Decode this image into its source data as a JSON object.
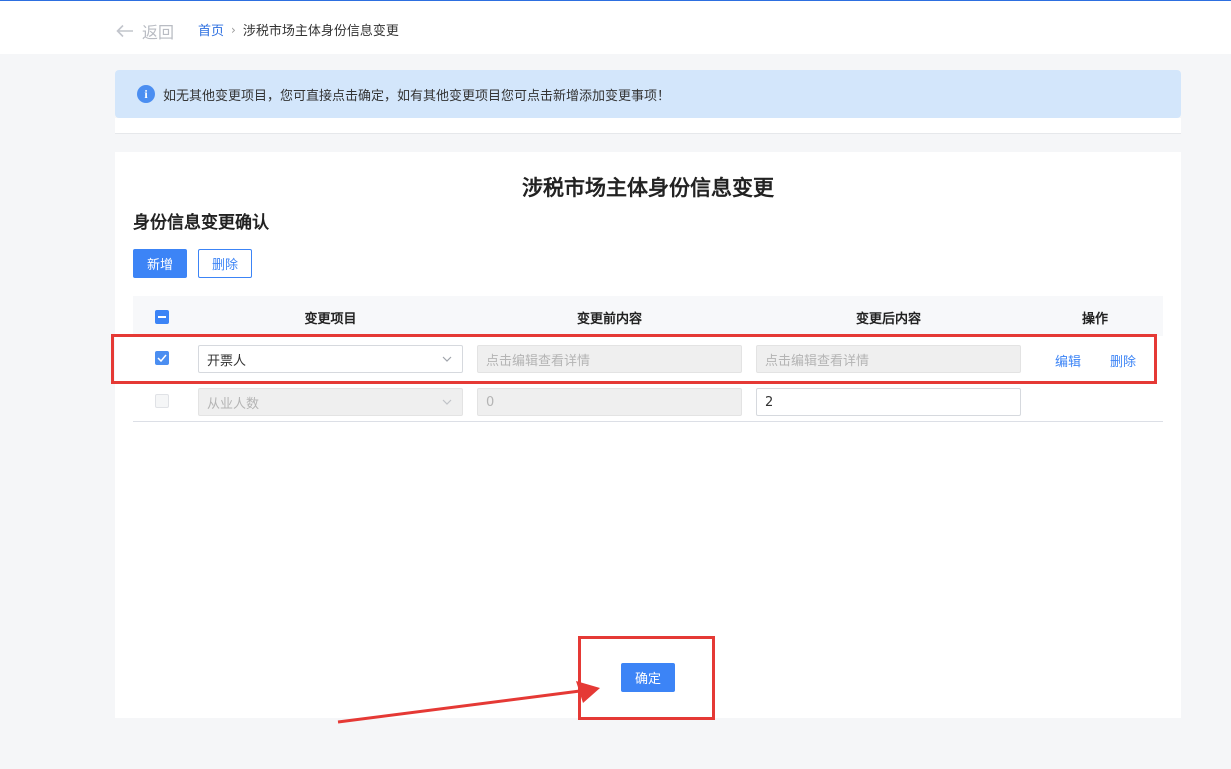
{
  "header": {
    "back_label": "返回",
    "breadcrumb_home": "首页",
    "breadcrumb_current": "涉税市场主体身份信息变更"
  },
  "notice": {
    "icon_glyph": "i",
    "text": "如无其他变更项目，您可直接点击确定，如有其他变更项目您可点击新增添加变更事项！"
  },
  "page_title": "涉税市场主体身份信息变更",
  "section_title": "身份信息变更确认",
  "toolbar": {
    "add_label": "新增",
    "delete_label": "删除"
  },
  "table": {
    "headers": {
      "item": "变更项目",
      "before": "变更前内容",
      "after": "变更后内容",
      "actions": "操作"
    },
    "rows": [
      {
        "checked": true,
        "item": "开票人",
        "before_placeholder": "点击编辑查看详情",
        "after_placeholder": "点击编辑查看详情",
        "edit_label": "编辑",
        "delete_label": "删除"
      },
      {
        "checked": false,
        "item": "从业人数",
        "before_value": "0",
        "after_value": "2"
      }
    ]
  },
  "confirm_label": "确定",
  "colors": {
    "accent": "#3c84f6",
    "annotation_red": "#e53935",
    "notice_bg": "#d3e6fb"
  }
}
